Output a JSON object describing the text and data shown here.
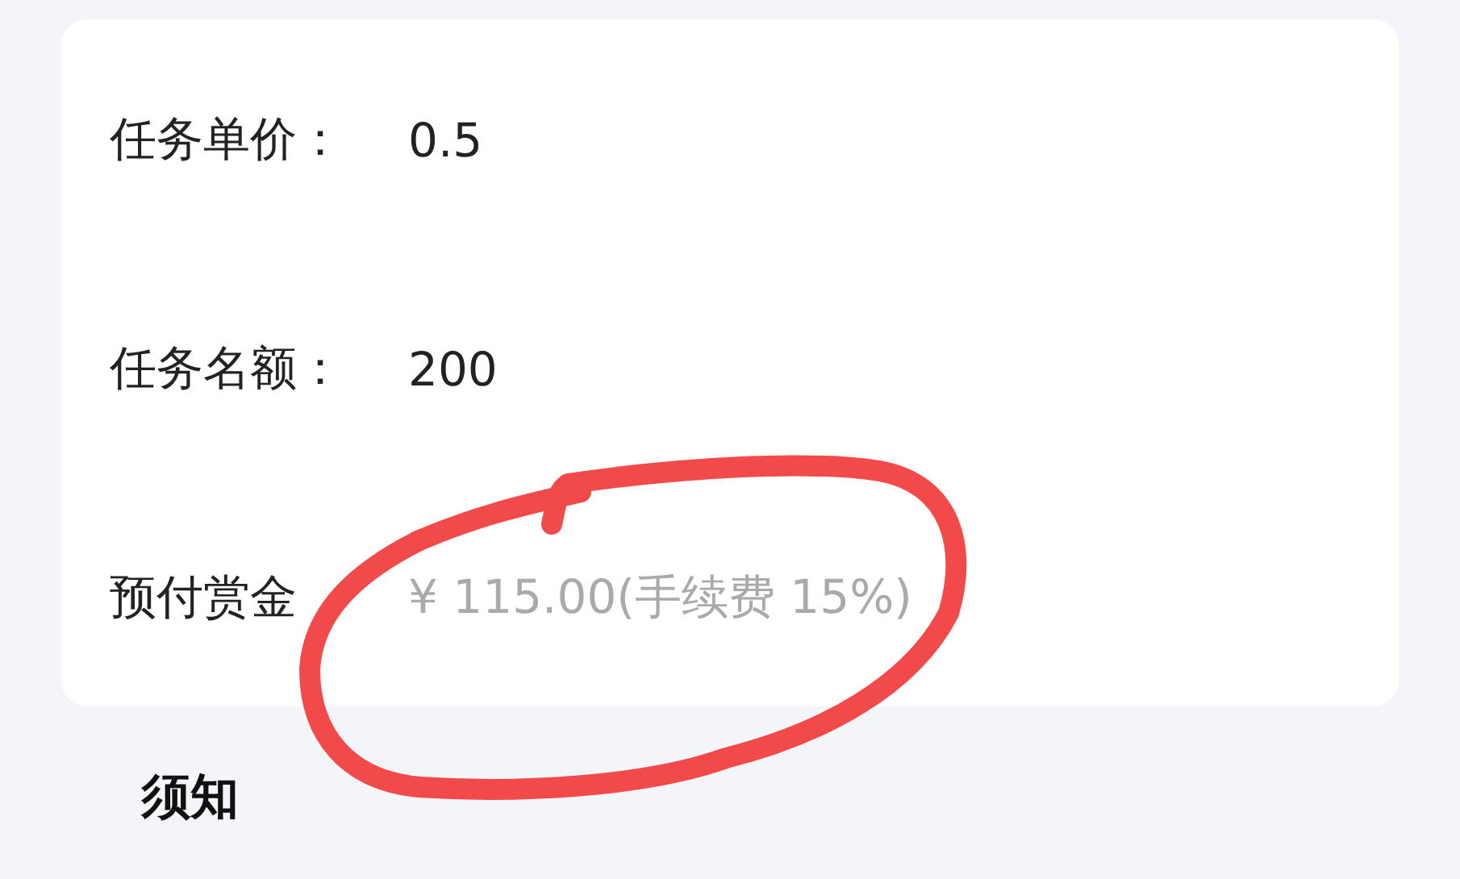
{
  "card": {
    "fields": [
      {
        "label": "任务单价：",
        "value": "0.5",
        "muted": false
      },
      {
        "label": "任务名额：",
        "value": "200",
        "muted": false
      },
      {
        "label": "预付赏金",
        "value": "¥ 115.00(手续费 15%)",
        "muted": true
      }
    ]
  },
  "section_heading": "须知"
}
